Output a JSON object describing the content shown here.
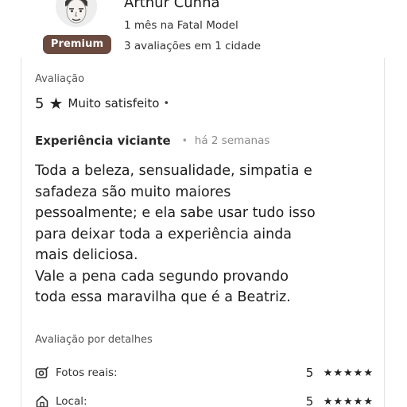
{
  "reviewer": {
    "name": "Arthur Cunha",
    "member_since": "1 mês na Fatal Model",
    "badge": "Premium",
    "stats": "3 avaliações em 1 cidade"
  },
  "rating": {
    "label": "Avaliação",
    "score": "5",
    "star": "★",
    "text": "Muito satisfeito",
    "dot": "•"
  },
  "review": {
    "title": "Experiência viciante",
    "separator": "•",
    "date": "há 2 semanas",
    "lines": [
      "Toda a beleza, sensualidade, simpatia e",
      "safadeza são muito maiores",
      "pessoalmente; e ela sabe usar tudo isso",
      "para deixar toda a experiência ainda",
      "mais deliciosa.",
      "Vale a pena cada segundo provando",
      "toda essa maravilha que é a Beatriz."
    ]
  },
  "details": {
    "label": "Avaliação por detalhes",
    "items": [
      {
        "icon": "photo-check-icon",
        "label": "Fotos reais:",
        "score": "5",
        "stars": "★★★★★"
      },
      {
        "icon": "home-icon",
        "label": "Local:",
        "score": "5",
        "stars": "★★★★★"
      }
    ]
  },
  "colors": {
    "badge_bg": "#6b4b40",
    "badge_text": "#ffffff",
    "text_primary": "#1e1e1e",
    "text_muted": "#8a8a8a"
  }
}
